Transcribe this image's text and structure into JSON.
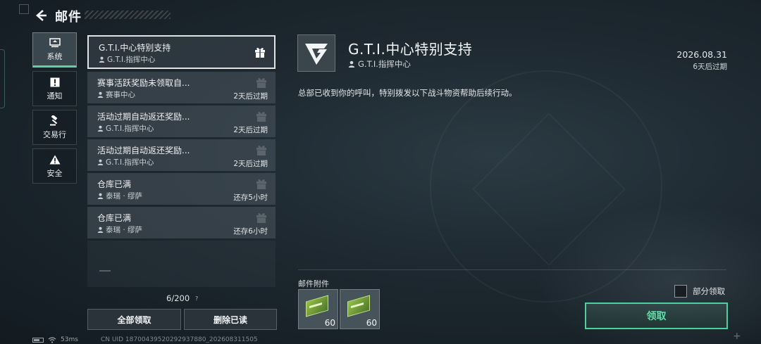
{
  "header": {
    "title": "邮件"
  },
  "nav": [
    {
      "label": "系统",
      "icon": "system-icon",
      "active": true
    },
    {
      "label": "通知",
      "icon": "notice-icon",
      "active": false
    },
    {
      "label": "交易行",
      "icon": "gavel-icon",
      "active": false
    },
    {
      "label": "安全",
      "icon": "warning-icon",
      "active": false
    }
  ],
  "mails": [
    {
      "title": "G.T.I.中心特别支持",
      "sender": "G.T.I.指挥中心",
      "expire": "",
      "selected": true
    },
    {
      "title": "赛事活跃奖励未领取自...",
      "sender": "赛事中心",
      "expire": "2天后过期",
      "selected": false
    },
    {
      "title": "活动过期自动返还奖励...",
      "sender": "G.T.I.指挥中心",
      "expire": "2天后过期",
      "selected": false
    },
    {
      "title": "活动过期自动返还奖励...",
      "sender": "G.T.I.指挥中心",
      "expire": "2天后过期",
      "selected": false
    },
    {
      "title": "仓库已满",
      "sender": "泰瑞 · 缪萨",
      "expire": "还存5小时",
      "selected": false
    },
    {
      "title": "仓库已满",
      "sender": "泰瑞 · 缪萨",
      "expire": "还存6小时",
      "selected": false
    }
  ],
  "counter": "6/200",
  "counter_help": "?",
  "buttons": {
    "claim_all": "全部领取",
    "delete_read": "删除已读",
    "claim": "领取"
  },
  "status": {
    "ping": "53ms",
    "uid": "CN UID 18700439520292937880_202608311505"
  },
  "detail": {
    "title": "G.T.I.中心特别支持",
    "sender": "G.T.I.指挥中心",
    "date": "2026.08.31",
    "expire": "6天后过期",
    "body": "总部已收到你的呼叫，特别拨发以下战斗物资帮助后续行动。",
    "attachments_label": "邮件附件",
    "attachments": [
      {
        "qty": "60"
      },
      {
        "qty": "60"
      }
    ],
    "partial_label": "部分领取"
  },
  "colors": {
    "accent": "#58d5a4",
    "claim_text": "#5fe0a9"
  }
}
